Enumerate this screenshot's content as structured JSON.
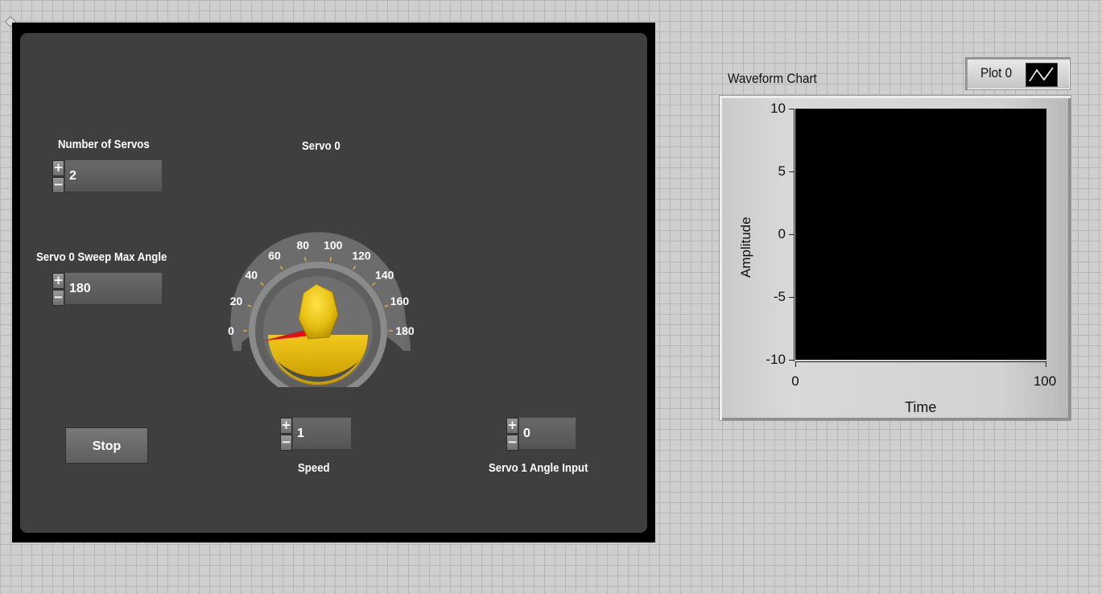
{
  "front_panel": {
    "number_of_servos": {
      "label": "Number of Servos",
      "value": "2"
    },
    "sweep_max_angle": {
      "label": "Servo 0 Sweep Max Angle",
      "value": "180"
    },
    "stop_button": {
      "label": "Stop"
    },
    "gauge": {
      "label": "Servo 0",
      "value": 0,
      "scale_min": 0,
      "scale_max": 180,
      "ticks": [
        "0",
        "20",
        "40",
        "60",
        "80",
        "100",
        "120",
        "140",
        "160",
        "180"
      ],
      "needle_color": "#e01010",
      "knob_color": "#e6bf10"
    },
    "speed": {
      "label": "Speed",
      "value": "1"
    },
    "servo1_angle": {
      "label": "Servo 1 Angle Input",
      "value": "0"
    },
    "increment_glyph": "+",
    "decrement_glyph": "−"
  },
  "waveform_chart": {
    "title": "Waveform Chart",
    "legend": {
      "plot_name": "Plot 0"
    },
    "y_label": "Amplitude",
    "x_label": "Time",
    "y_ticks": [
      "10",
      "5",
      "0",
      "-5",
      "-10"
    ],
    "x_ticks": [
      "0",
      "100"
    ]
  },
  "chart_data": {
    "type": "line",
    "title": "Waveform Chart",
    "xlabel": "Time",
    "ylabel": "Amplitude",
    "xlim": [
      0,
      100
    ],
    "ylim": [
      -10,
      10
    ],
    "series": [
      {
        "name": "Plot 0",
        "values": []
      }
    ],
    "legend": "top-right",
    "grid": false
  }
}
